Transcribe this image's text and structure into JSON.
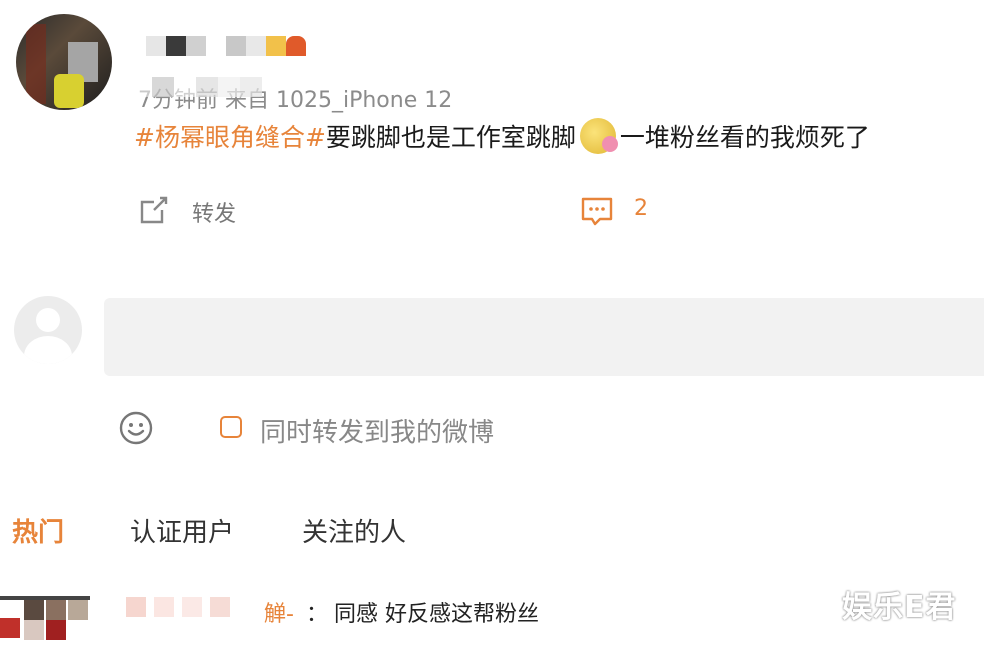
{
  "post": {
    "meta": "7分钟前 来自 1025_iPhone 12",
    "hashtag": "#杨幂眼角缝合#",
    "content_part1": "要跳脚也是工作室跳脚",
    "content_part2": "一堆粉丝看的我烦死了",
    "actions": {
      "forward_label": "转发",
      "comment_count": "2"
    }
  },
  "composer": {
    "input_placeholder": "",
    "sync_label": "同时转发到我的微博"
  },
  "tabs": [
    {
      "label": "热门",
      "active": true
    },
    {
      "label": "认证用户",
      "active": false
    },
    {
      "label": "关注的人",
      "active": false
    }
  ],
  "reply": {
    "name_tail": "觯-",
    "separator": "：",
    "text": "同感 好反感这帮粉丝"
  },
  "watermark": "娱乐E君",
  "colors": {
    "accent": "#e7843a",
    "muted_text": "#8b8b8b",
    "input_bg": "#f2f2f2"
  }
}
